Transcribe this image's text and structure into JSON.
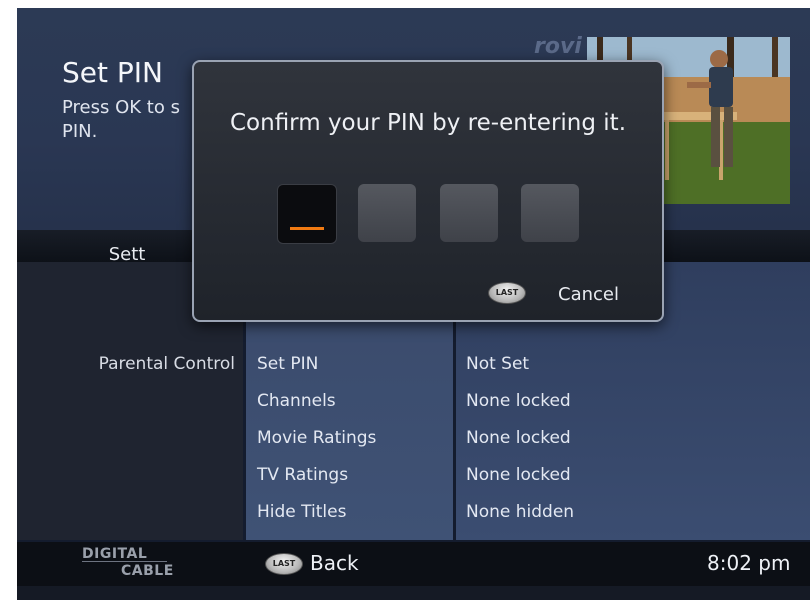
{
  "header": {
    "title": "Set PIN",
    "description": "Press OK to s\nPIN.",
    "logo": "rovi"
  },
  "columns": {
    "left_title": "Sett"
  },
  "category": "Parental Control",
  "menu": [
    {
      "label": "Set PIN",
      "value": "Not Set"
    },
    {
      "label": "Channels",
      "value": "None locked"
    },
    {
      "label": "Movie Ratings",
      "value": "None locked"
    },
    {
      "label": "TV Ratings",
      "value": "None locked"
    },
    {
      "label": "Hide Titles",
      "value": "None hidden"
    }
  ],
  "dialog": {
    "message": "Confirm your PIN by re-entering it.",
    "pin_digits_total": 4,
    "active_digit_index": 0,
    "last_button_text": "LAST",
    "cancel_label": "Cancel"
  },
  "footer": {
    "brand_line1": "DIGITAL",
    "brand_line2": "CABLE",
    "last_button_text": "LAST",
    "back_label": "Back",
    "time": "8:02 pm"
  },
  "colors": {
    "cursor": "#f07a12",
    "header_bg": "#2c3a55",
    "mid_column_bg": "#3f5275"
  }
}
